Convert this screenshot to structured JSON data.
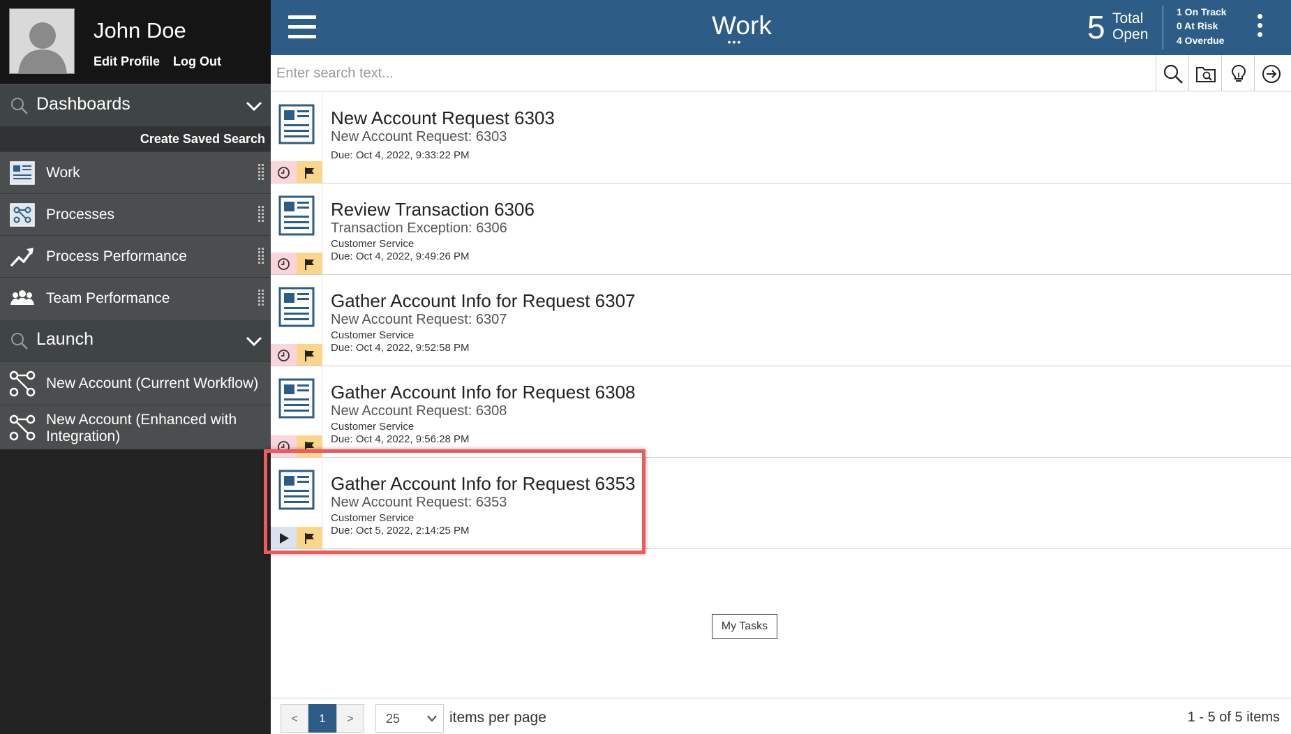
{
  "profile": {
    "name": "John Doe",
    "edit_profile": "Edit Profile",
    "log_out": "Log Out"
  },
  "sidebar": {
    "dashboards_title": "Dashboards",
    "create_saved_search": "Create Saved Search",
    "items": [
      {
        "label": "Work",
        "icon": "work-icon"
      },
      {
        "label": "Processes",
        "icon": "processes-icon"
      },
      {
        "label": "Process Performance",
        "icon": "trend-chart-icon"
      },
      {
        "label": "Team Performance",
        "icon": "team-icon"
      }
    ],
    "launch_title": "Launch",
    "launch_items": [
      {
        "label": "New Account (Current Workflow)",
        "icon": "workflow-icon"
      },
      {
        "label": "New Account (Enhanced with",
        "label_line2": "Integration)",
        "icon": "workflow-icon"
      }
    ]
  },
  "header": {
    "title": "Work",
    "title_dots": "•••",
    "total_count": "5",
    "total_label_1": "Total",
    "total_label_2": "Open",
    "on_track": "1 On Track",
    "at_risk": "0 At Risk",
    "overdue": "4 Overdue",
    "bg_color": "#2d5d86"
  },
  "search": {
    "placeholder": "Enter search text..."
  },
  "tasks": [
    {
      "title": "New Account Request 6303",
      "subtitle": "New Account Request: 6303",
      "team": "",
      "due": "Due: Oct 4, 2022, 9:33:22 PM",
      "indicator": "clock"
    },
    {
      "title": "Review Transaction 6306",
      "subtitle": "Transaction Exception: 6306",
      "team": "Customer Service",
      "due": "Due: Oct 4, 2022, 9:49:26 PM",
      "indicator": "clock"
    },
    {
      "title": "Gather Account Info for Request 6307",
      "subtitle": "New Account Request: 6307",
      "team": "Customer Service",
      "due": "Due: Oct 4, 2022, 9:52:58 PM",
      "indicator": "clock"
    },
    {
      "title": "Gather Account Info for Request 6308",
      "subtitle": "New Account Request: 6308",
      "team": "Customer Service",
      "due": "Due: Oct 4, 2022, 9:56:28 PM",
      "indicator": "clock"
    },
    {
      "title": "Gather Account Info for Request 6353",
      "subtitle": "New Account Request: 6353",
      "team": "Customer Service",
      "due": "Due: Oct 5, 2022, 2:14:25 PM",
      "indicator": "play"
    }
  ],
  "my_tasks_button": "My Tasks",
  "pagination": {
    "prev": "<",
    "current": "1",
    "next": ">",
    "per_page": "25",
    "per_page_label": "items per page",
    "range": "1 - 5 of 5 items"
  }
}
